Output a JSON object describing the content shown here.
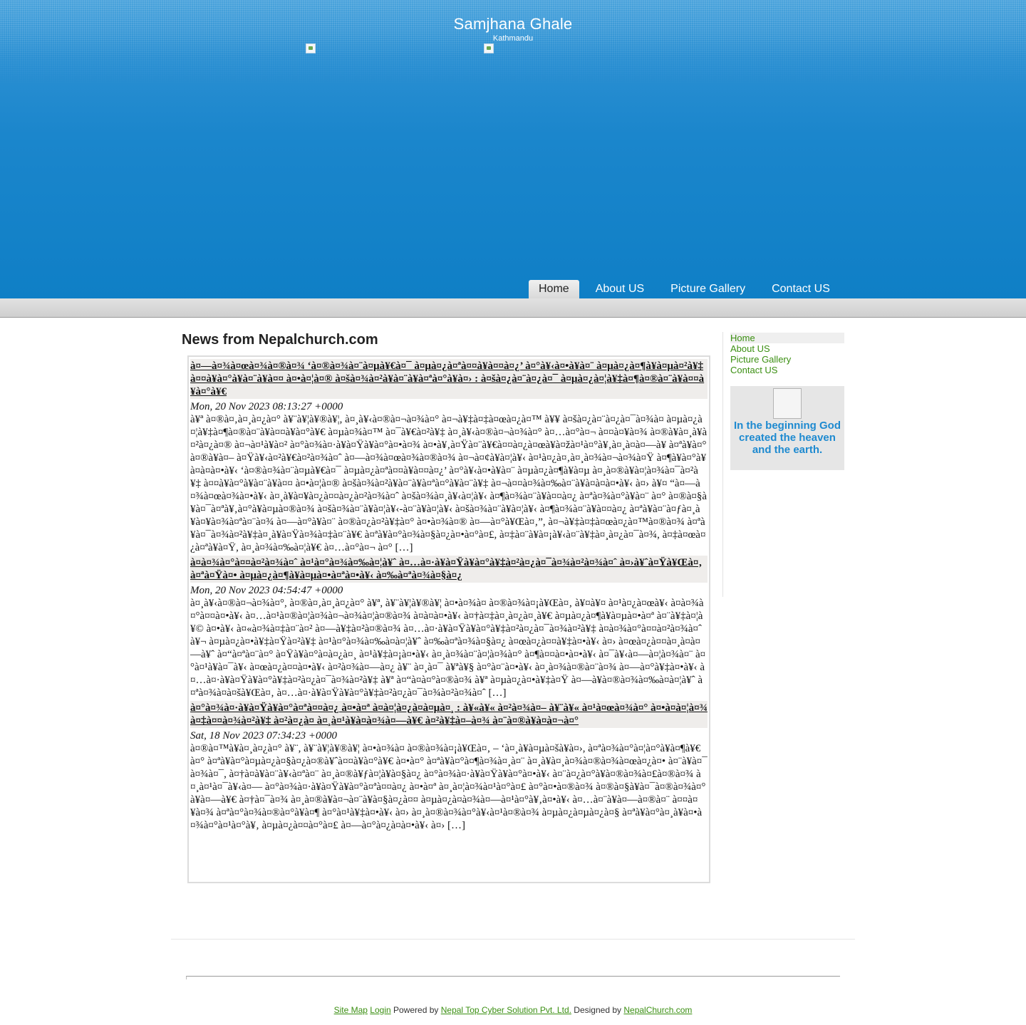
{
  "header": {
    "title": "Samjhana Ghale",
    "subtitle": "Kathmandu"
  },
  "nav": {
    "items": [
      {
        "label": "Home",
        "active": true
      },
      {
        "label": "About US"
      },
      {
        "label": "Picture Gallery"
      },
      {
        "label": "Contact US"
      }
    ]
  },
  "main": {
    "heading": "News from Nepalchurch.com",
    "articles": [
      {
        "title": "à¤—à¤¾à¤œà¤¾à¤®à¤¾ ‘à¤®à¤¾à¤¨à¤µà¥€à¤¯ à¤µà¤¿à¤ªà¤¤à¥à¤¤à¤¿’ à¤°à¥‹à¤•à¥à¤¨ à¤µà¤¿à¤¶à¥à¤µà¤²à¥‡ à¤¤à¥à¤°à¥à¤¨à¥à¤¤ à¤•à¤¦à¤® à¤šà¤¾à¤²à¥à¤¨à¥à¤ªà¤°à¥à¤› : à¤šà¤¿à¤¨à¤¿à¤¯ à¤µà¤¿à¤¦à¥‡à¤¶à¤®à¤¨à¥à¤¤à¥à¤°à¥€",
        "date": "Mon, 20 Nov 2023 08:13:27 +0000",
        "body": "à¥ª à¤®à¤‚à¤¸à¤¿à¤° à¥¨à¥¦à¥®à¥¦, à¤¸à¥‹à¤®à¤¬à¤¾à¤° à¤¬à¥‡à¤‡à¤œà¤¿à¤™ à¥¥ à¤šà¤¿à¤¨à¤¿à¤¯à¤¾à¤ à¤µà¤¿à¤¦à¥‡à¤¶à¤®à¤¨à¥à¤¤à¥à¤°à¥€ à¤µà¤¾à¤™ à¤¯à¥€à¤²à¥‡ à¤¸à¥‹à¤®à¤¬à¤¾à¤° à¤…à¤°à¤¬ à¤¤à¤¥à¤¾ à¤®à¥à¤¸à¥à¤²à¤¿à¤® à¤¬à¤¹à¥à¤² à¤°à¤¾à¤·à¥à¤Ÿà¥à¤°à¤•à¤¾ à¤•à¥‚à¤Ÿà¤¨à¥€à¤¤à¤¿à¤œà¥à¤žà¤¹à¤°à¥‚à¤¸à¤à¤—à¥ à¤ªà¥à¤°à¤®à¥à¤– à¤Ÿà¥‹à¤²à¥€à¤²à¤¾à¤ˆ à¤—à¤¾à¤œà¤¾à¤®à¤¾ à¤¬à¤¢à¥à¤¦à¥‹ à¤¹à¤¿à¤‚à¤¸à¤¾à¤¬à¤¾à¤Ÿ à¤¶à¥à¤°à¥ à¤­à¤à¤•à¥‹ ‘à¤®à¤¾à¤¨à¤µà¥€à¤¯ à¤µà¤¿à¤ªà¤¤à¥à¤¤à¤¿’ à¤°à¥‹à¤•à¥à¤¨ à¤µà¤¿à¤¶à¥à¤µ à¤¸à¤®à¥à¤¦à¤¾à¤¯à¤²à¥‡ à¤¤à¥à¤°à¥à¤¨à¥à¤¤ à¤•à¤¦à¤® à¤šà¤¾à¤²à¥à¤¨à¥à¤ªà¤°à¥à¤¨à¥‡ à¤¬à¤¤à¤¾à¤‰à¤¨à¥à¤­à¤à¤•à¥‹ à¤› à¥¤ “à¤—à¤¾à¤œà¤¾à¤•à¥‹ à¤¸à¥à¤¥à¤¿à¤¤à¤¿à¤²à¤¾à¤ˆ à¤šà¤¾à¤¸à¥‹à¤¦à¥‹ à¤¶à¤¾à¤¨à¥à¤¤à¤¿ à¤ªà¤¾à¤°à¥à¤¨ à¤° à¤®à¤§à¥à¤¯à¤ªà¥‚à¤°à¥à¤µà¤®à¤¾ à¤šà¤¾à¤¨à¥à¤¦à¥‹-à¤¨à¥à¤¦à¥‹ à¤šà¤¾à¤¨à¥à¤¦à¥‹ à¤¶à¤¾à¤¨à¥à¤¤à¤¿ à¤ªà¥à¤¨à¤ƒà¤¸à¥à¤¥à¤¾à¤ªà¤¨à¤¾ à¤—à¤°à¥à¤¨ à¤®à¤¿à¤²à¥‡à¤° à¤•à¤¾à¤® à¤—à¤°à¥Œà¤‚”, à¤¬à¥‡à¤‡à¤œà¤¿à¤™à¤®à¤¾ à¤ªà¥à¤¯à¤¾à¤²à¥‡à¤¸à¥à¤Ÿà¤¾à¤‡à¤¨à¥€ à¤ªà¥à¤°à¤¾à¤§à¤¿à¤•à¤°à¤£, à¤‡à¤¨à¥à¤¡à¥‹à¤¨à¥‡à¤¸à¤¿à¤¯à¤¾, à¤‡à¤œà¤¿à¤ªà¥à¤Ÿ, à¤¸à¤¾à¤‰à¤¦à¥€ à¤…à¤°à¤¬ à¤° […]"
      },
      {
        "title": "à¤à¤¾à¤°à¤¤à¤²à¤¾à¤ˆ à¤¹à¤°à¤¾à¤‰à¤¦à¥ˆ à¤…à¤·à¥à¤Ÿà¥à¤°à¥‡à¤²à¤¿à¤¯à¤¾à¤²à¤¾à¤ˆ à¤›à¥ˆà¤Ÿà¥Œà¤‚ à¤ªà¤Ÿà¤• à¤µà¤¿à¤¶à¥à¤µà¤•à¤ªà¤•à¥‹ à¤‰à¤ªà¤¾à¤§à¤¿",
        "date": "Mon, 20 Nov 2023 04:54:47 +0000",
        "body": "à¤¸à¥‹à¤®à¤¬à¤¾à¤°, à¤®à¤‚à¤¸à¤¿à¤° à¥ª, à¥¨à¥¦à¥®à¥¦ à¤•à¤¾à¤ à¤®à¤¾à¤¡à¥Œà¤‚ à¥¤à¥¤ à¤¹à¤¿à¤œà¥‹ à¤à¤¾à¤°à¤¤à¤•à¥‹ à¤…à¤¹à¤®à¤¦à¤¾à¤¬à¤¾à¤¦à¤®à¤¾ à¤à¤à¤•à¥‹ à¤†à¤‡à¤¸à¤¿à¤¸à¥€ à¤µà¤¿à¤¶à¥à¤µà¤•à¤ª à¤¨à¥‡à¤¦à¥© à¤•à¥‹ à¤«à¤¾à¤‡à¤¨à¤² à¤—à¥‡à¤²à¤®à¤¾ à¤…à¤·à¥à¤Ÿà¥à¤°à¥‡à¤²à¤¿à¤¯à¤¾à¤²à¥‡ à¤à¤¾à¤°à¤¤à¤²à¤¾à¤ˆ à¥¬ à¤µà¤¿à¤•à¥‡à¤Ÿà¤²à¥‡ à¤¹à¤°à¤¾à¤‰à¤à¤¦à¥ˆ à¤‰à¤ªà¤¾à¤§à¤¿ à¤œà¤¿à¤¤à¥‡à¤•à¥‹ à¤› à¤œà¤¿à¤¤à¤¸à¤à¤—à¥ˆ à¤“à¤ªà¤¨à¤° à¤Ÿà¥à¤°à¤­à¤¿à¤¸ à¤¹à¥‡à¤¡à¤•à¥‹ à¤¸à¤¾à¤¨à¤¦à¤¾à¤° à¤¶à¤¤à¤•à¤•à¥‹ à¤¯à¥‹à¤—à¤¦à¤¾à¤¨ à¤°à¤¹à¥à¤¯à¥‹ à¤œà¤¿à¤¤à¤•à¥‹ à¤²à¤¾à¤—à¤¿ à¥¨ à¤¸à¤¯ à¥ªà¥§ à¤°à¤¨à¤•à¥‹ à¤¸à¤¾à¤®à¤¨à¤¾ à¤—à¤°à¥‡à¤•à¥‹ à¤…à¤·à¥à¤Ÿà¥à¤°à¥‡à¤²à¤¿à¤¯à¤¾à¤²à¥‡ à¥ª à¤“à¤à¤°à¤®à¤¾ à¥ª à¤µà¤¿à¤•à¥‡à¤Ÿ à¤—à¥à¤®à¤¾à¤‰à¤à¤¦à¥ˆ à¤ªà¤¾à¤à¤šà¥Œà¤‚ à¤…à¤·à¥à¤Ÿà¥à¤°à¥‡à¤²à¤¿à¤¯à¤¾à¤²à¤¾à¤ˆ […]"
      },
      {
        "title": "à¤°à¤¾à¤·à¥à¤Ÿà¥à¤°à¤ªà¤¤à¤¿ à¤•à¤ª à¤à¤¦à¤¿à¤à¤µà¤¸ : à¥«à¥« à¤²à¤¾à¤– à¥¨à¥« à¤¹à¤œà¤¾à¤° à¤•à¤à¤¦à¤¾à¤‡à¤¤à¤¾à¤²à¥‡ à¤²à¤¿à¤ à¤¸à¤¹à¥à¤à¤¾à¤—à¥€ à¤²à¥‡à¤–à¤¾ à¤¨à¤®à¥à¤à¤¬à¤°",
        "date": "Sat, 18 Nov 2023 07:34:23 +0000",
        "body": "à¤®à¤™à¥à¤¸à¤¿à¤° à¥¨, à¥¨à¥¦à¥®à¥¦ à¤•à¤¾à¤ à¤®à¤¾à¤¡à¥Œà¤‚ – ‘à¤¸à¥à¤µà¤šà¥à¤›, à¤ªà¤¾à¤°à¤¦à¤°à¥à¤¶à¥€ à¤° à¤ªà¥à¤°à¤µà¤¿à¤§à¤¿à¤®à¥ˆà¤¤à¥à¤°à¥€ à¤•à¤° à¤ªà¥à¤°à¤¶à¤¾à¤¸à¤¨ à¤¸à¥à¤¸à¤¾à¤®à¤¾à¤œà¤¿à¤• à¤¨à¥à¤¯à¤¾à¤¯, à¤†à¤à¥à¤¨à¥‹à¤ªà¤¨ à¤¸à¤®à¥ƒà¤¦à¥à¤§à¤¿ à¤°à¤¾à¤·à¥à¤Ÿà¥à¤°à¤•à¥‹ à¤¨à¤¿à¤°à¥à¤®à¤¾à¤£à¤®à¤¾ à¤¸à¤¹à¤¯à¥‹à¤— à¤°à¤¾à¤·à¥à¤Ÿà¥à¤°à¤ªà¤¤à¤¿ à¤•à¤ª à¤¸à¤¦à¤¾à¤¹à¤°à¤£ à¤°à¤•à¤®à¤¾ à¤®à¤§à¥à¤¯à¤®à¤¾à¤°à¥à¤—à¥€ à¤†à¤¯à¤¾ à¤¸à¤®à¥à¤¬à¤¨à¥à¤§à¤¿à¤¤ à¤µà¤¿à¤à¤¾à¤—à¤¹à¤°à¥‚à¤•à¥‹ à¤…à¤¨à¥à¤—à¤®à¤¨ à¤¤à¤¥à¤¾ à¤ªà¤°à¤¾à¤®à¤°à¥à¤¶ à¤°à¤¹à¥‡à¤•à¥‹ à¤› à¤¸à¤®à¤¾à¤°à¥‹à¤¹à¤®à¤¾ à¤µà¤¿à¤µà¤¿à¤§ à¤ªà¥à¤°à¤¸à¥à¤•à¤¾à¤°à¤¹à¤°à¥‚ à¤µà¤¿à¤¤à¤°à¤£ à¤—à¤°à¤¿à¤à¤•à¥‹ à¤› […]"
      }
    ]
  },
  "sidebar": {
    "links": [
      {
        "label": "Home",
        "active": true
      },
      {
        "label": "About US"
      },
      {
        "label": "Picture Gallery"
      },
      {
        "label": "Contact US"
      }
    ],
    "verse": "In the beginning God created the heaven and the earth."
  },
  "footer": {
    "sitemap": "Site Map",
    "login": "Login",
    "powered_by": "Powered by",
    "company": "Nepal Top Cyber Solution Pvt. Ltd.",
    "designed_by": "Designed by",
    "designer": "NepalChurch.com"
  }
}
